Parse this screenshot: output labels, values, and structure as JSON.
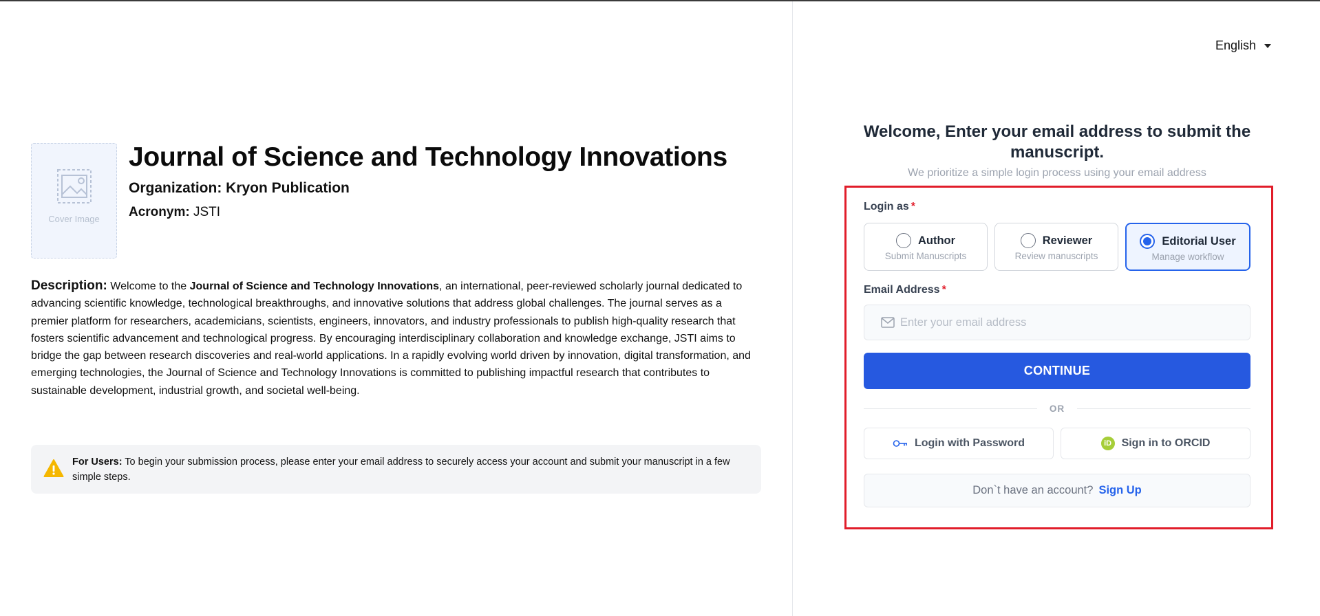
{
  "header": {
    "language": "English"
  },
  "journal": {
    "cover_label": "Cover Image",
    "title": "Journal of Science and Technology Innovations",
    "organization": "Organization: Kryon Publication",
    "acronym_label": "Acronym:",
    "acronym_value": "JSTI"
  },
  "description": {
    "label": "Description:",
    "intro": " Welcome to the ",
    "journal_name": "Journal of Science and Technology Innovations",
    "body": ", an international, peer-reviewed scholarly journal dedicated to advancing scientific knowledge, technological breakthroughs, and innovative solutions that address global challenges. The journal serves as a premier platform for researchers, academicians, scientists, engineers, innovators, and industry professionals to publish high-quality research that fosters scientific advancement and technological progress. By encouraging interdisciplinary collaboration and knowledge exchange, JSTI aims to bridge the gap between research discoveries and real-world applications. In a rapidly evolving world driven by innovation, digital transformation, and emerging technologies, the Journal of Science and Technology Innovations is committed to publishing impactful research that contributes to sustainable development, industrial growth, and societal well-being."
  },
  "notice": {
    "icon": "warning-icon",
    "label": "For Users:",
    "text": " To begin your submission process, please enter your email address to securely access your account and submit your manuscript in a few simple steps."
  },
  "login": {
    "heading": "Welcome, Enter your email address to submit the manuscript.",
    "subheading": "We prioritize a simple login process using your email address",
    "role_label": "Login as",
    "required_mark": "*",
    "roles": [
      {
        "name": "Author",
        "description": "Submit Manuscripts",
        "selected": false
      },
      {
        "name": "Reviewer",
        "description": "Review manuscripts",
        "selected": false
      },
      {
        "name": "Editorial User",
        "description": "Manage workflow",
        "selected": true
      }
    ],
    "email_label": "Email Address",
    "email_placeholder": "Enter your email address",
    "email_value": "",
    "continue_label": "CONTINUE",
    "or_label": "OR",
    "password_login_label": "Login with Password",
    "orcid_label": "Sign in to ORCID",
    "orcid_icon_text": "iD",
    "signup_prompt": "Don`t have an account?",
    "signup_link": "Sign Up"
  },
  "colors": {
    "primary": "#2659e0",
    "selected_border": "#2563eb",
    "highlight_box": "#e11d2a",
    "warning": "#f5b700",
    "orcid": "#a6ce39"
  }
}
